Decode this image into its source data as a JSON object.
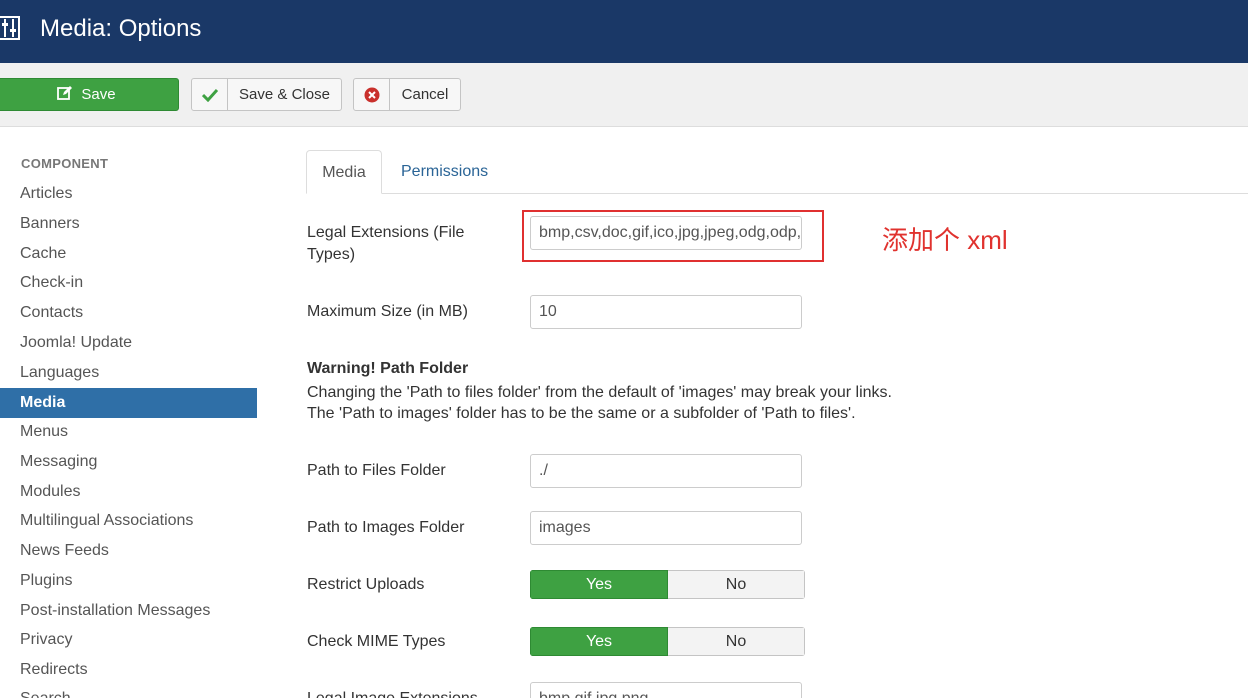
{
  "header": {
    "title": "Media: Options",
    "icon": "options-sliders-icon"
  },
  "toolbar": {
    "save_label": "Save",
    "save_close_label": "Save & Close",
    "cancel_label": "Cancel"
  },
  "sidebar": {
    "heading": "COMPONENT",
    "items": [
      {
        "label": "Articles"
      },
      {
        "label": "Banners"
      },
      {
        "label": "Cache"
      },
      {
        "label": "Check-in"
      },
      {
        "label": "Contacts"
      },
      {
        "label": "Joomla! Update"
      },
      {
        "label": "Languages"
      },
      {
        "label": "Media",
        "active": true
      },
      {
        "label": "Menus"
      },
      {
        "label": "Messaging"
      },
      {
        "label": "Modules"
      },
      {
        "label": "Multilingual Associations"
      },
      {
        "label": "News Feeds"
      },
      {
        "label": "Plugins"
      },
      {
        "label": "Post-installation Messages"
      },
      {
        "label": "Privacy"
      },
      {
        "label": "Redirects"
      },
      {
        "label": "Search"
      }
    ]
  },
  "tabs": [
    {
      "label": "Media",
      "active": true
    },
    {
      "label": "Permissions"
    }
  ],
  "form": {
    "legal_ext_label_1": "Legal Extensions (File",
    "legal_ext_label_2": "Types)",
    "legal_ext_value": "bmp,csv,doc,gif,ico,jpg,jpeg,odg,odp,ods,odt,pdf,png",
    "max_size_label": "Maximum Size (in MB)",
    "max_size_value": "10",
    "warning_title": "Warning! Path Folder",
    "warning_line1": "Changing the 'Path to files folder' from the default of 'images' may break your links.",
    "warning_line2": "The 'Path to images' folder has to be the same or a subfolder of 'Path to files'.",
    "path_files_label": "Path to Files Folder",
    "path_files_value": "./",
    "path_images_label": "Path to Images Folder",
    "path_images_value": "images",
    "restrict_label": "Restrict Uploads",
    "mime_label": "Check MIME Types",
    "yes_label": "Yes",
    "no_label": "No",
    "legal_image_label": "Legal Image Extensions",
    "legal_image_value": "bmp,gif,jpg,png"
  },
  "annotation": {
    "text": "添加个 xml",
    "color": "#e0322e"
  },
  "colors": {
    "header": "#1a3867",
    "accent": "#2f6fa7",
    "success": "#3ea142"
  }
}
